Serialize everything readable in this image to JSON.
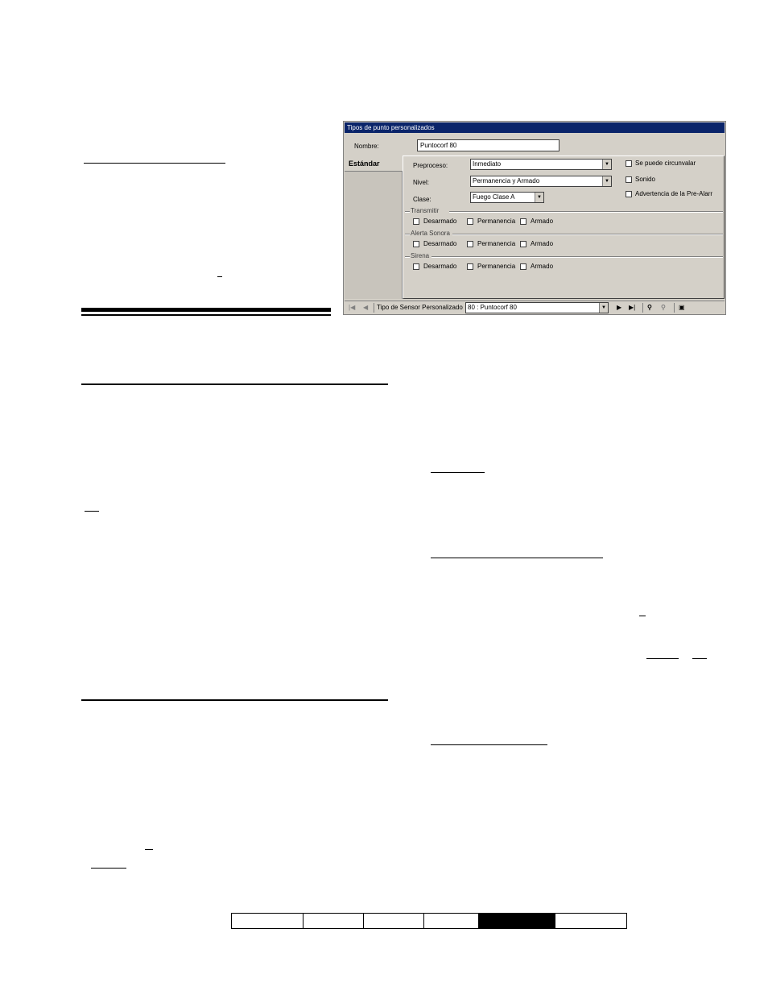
{
  "window": {
    "title": "Tipos de punto personalizados",
    "nombre_label": "Nombre:",
    "nombre_value": "Puntocorf 80",
    "tab_label": "Estándar",
    "preproceso_label": "Preproceso:",
    "preproceso_value": "Inmediato",
    "nivel_label": "Nivel:",
    "nivel_value": "Permanencia y Armado",
    "clase_label": "Clase:",
    "clase_value": "Fuego Clase A",
    "options": [
      {
        "label": "Se puede circunvalar"
      },
      {
        "label": "Sonido"
      },
      {
        "label": "Advertencia de la Pre-Alarr"
      }
    ],
    "groups": [
      {
        "title": "Transmitir",
        "items": [
          "Desarmado",
          "Permanencia",
          "Armado"
        ]
      },
      {
        "title": "Alerta Sonora",
        "items": [
          "Desarmado",
          "Permanencia",
          "Armado"
        ]
      },
      {
        "title": "Sirena",
        "items": [
          "Desarmado",
          "Permanencia",
          "Armado"
        ]
      }
    ],
    "nav": {
      "sensor_label": "Tipo de Sensor Personalizado",
      "sensor_value": "80 : Puntocorf 80",
      "first_glyph": "|◀",
      "prev_glyph": "◀",
      "next_glyph": "▶",
      "last_glyph": "▶|",
      "find_glyph": "⚲",
      "find_next_glyph": "⚲",
      "new_glyph": "▣",
      "dropdown_glyph": "▼"
    }
  },
  "footer": {
    "active_cell_index": 4,
    "cells": 6
  }
}
